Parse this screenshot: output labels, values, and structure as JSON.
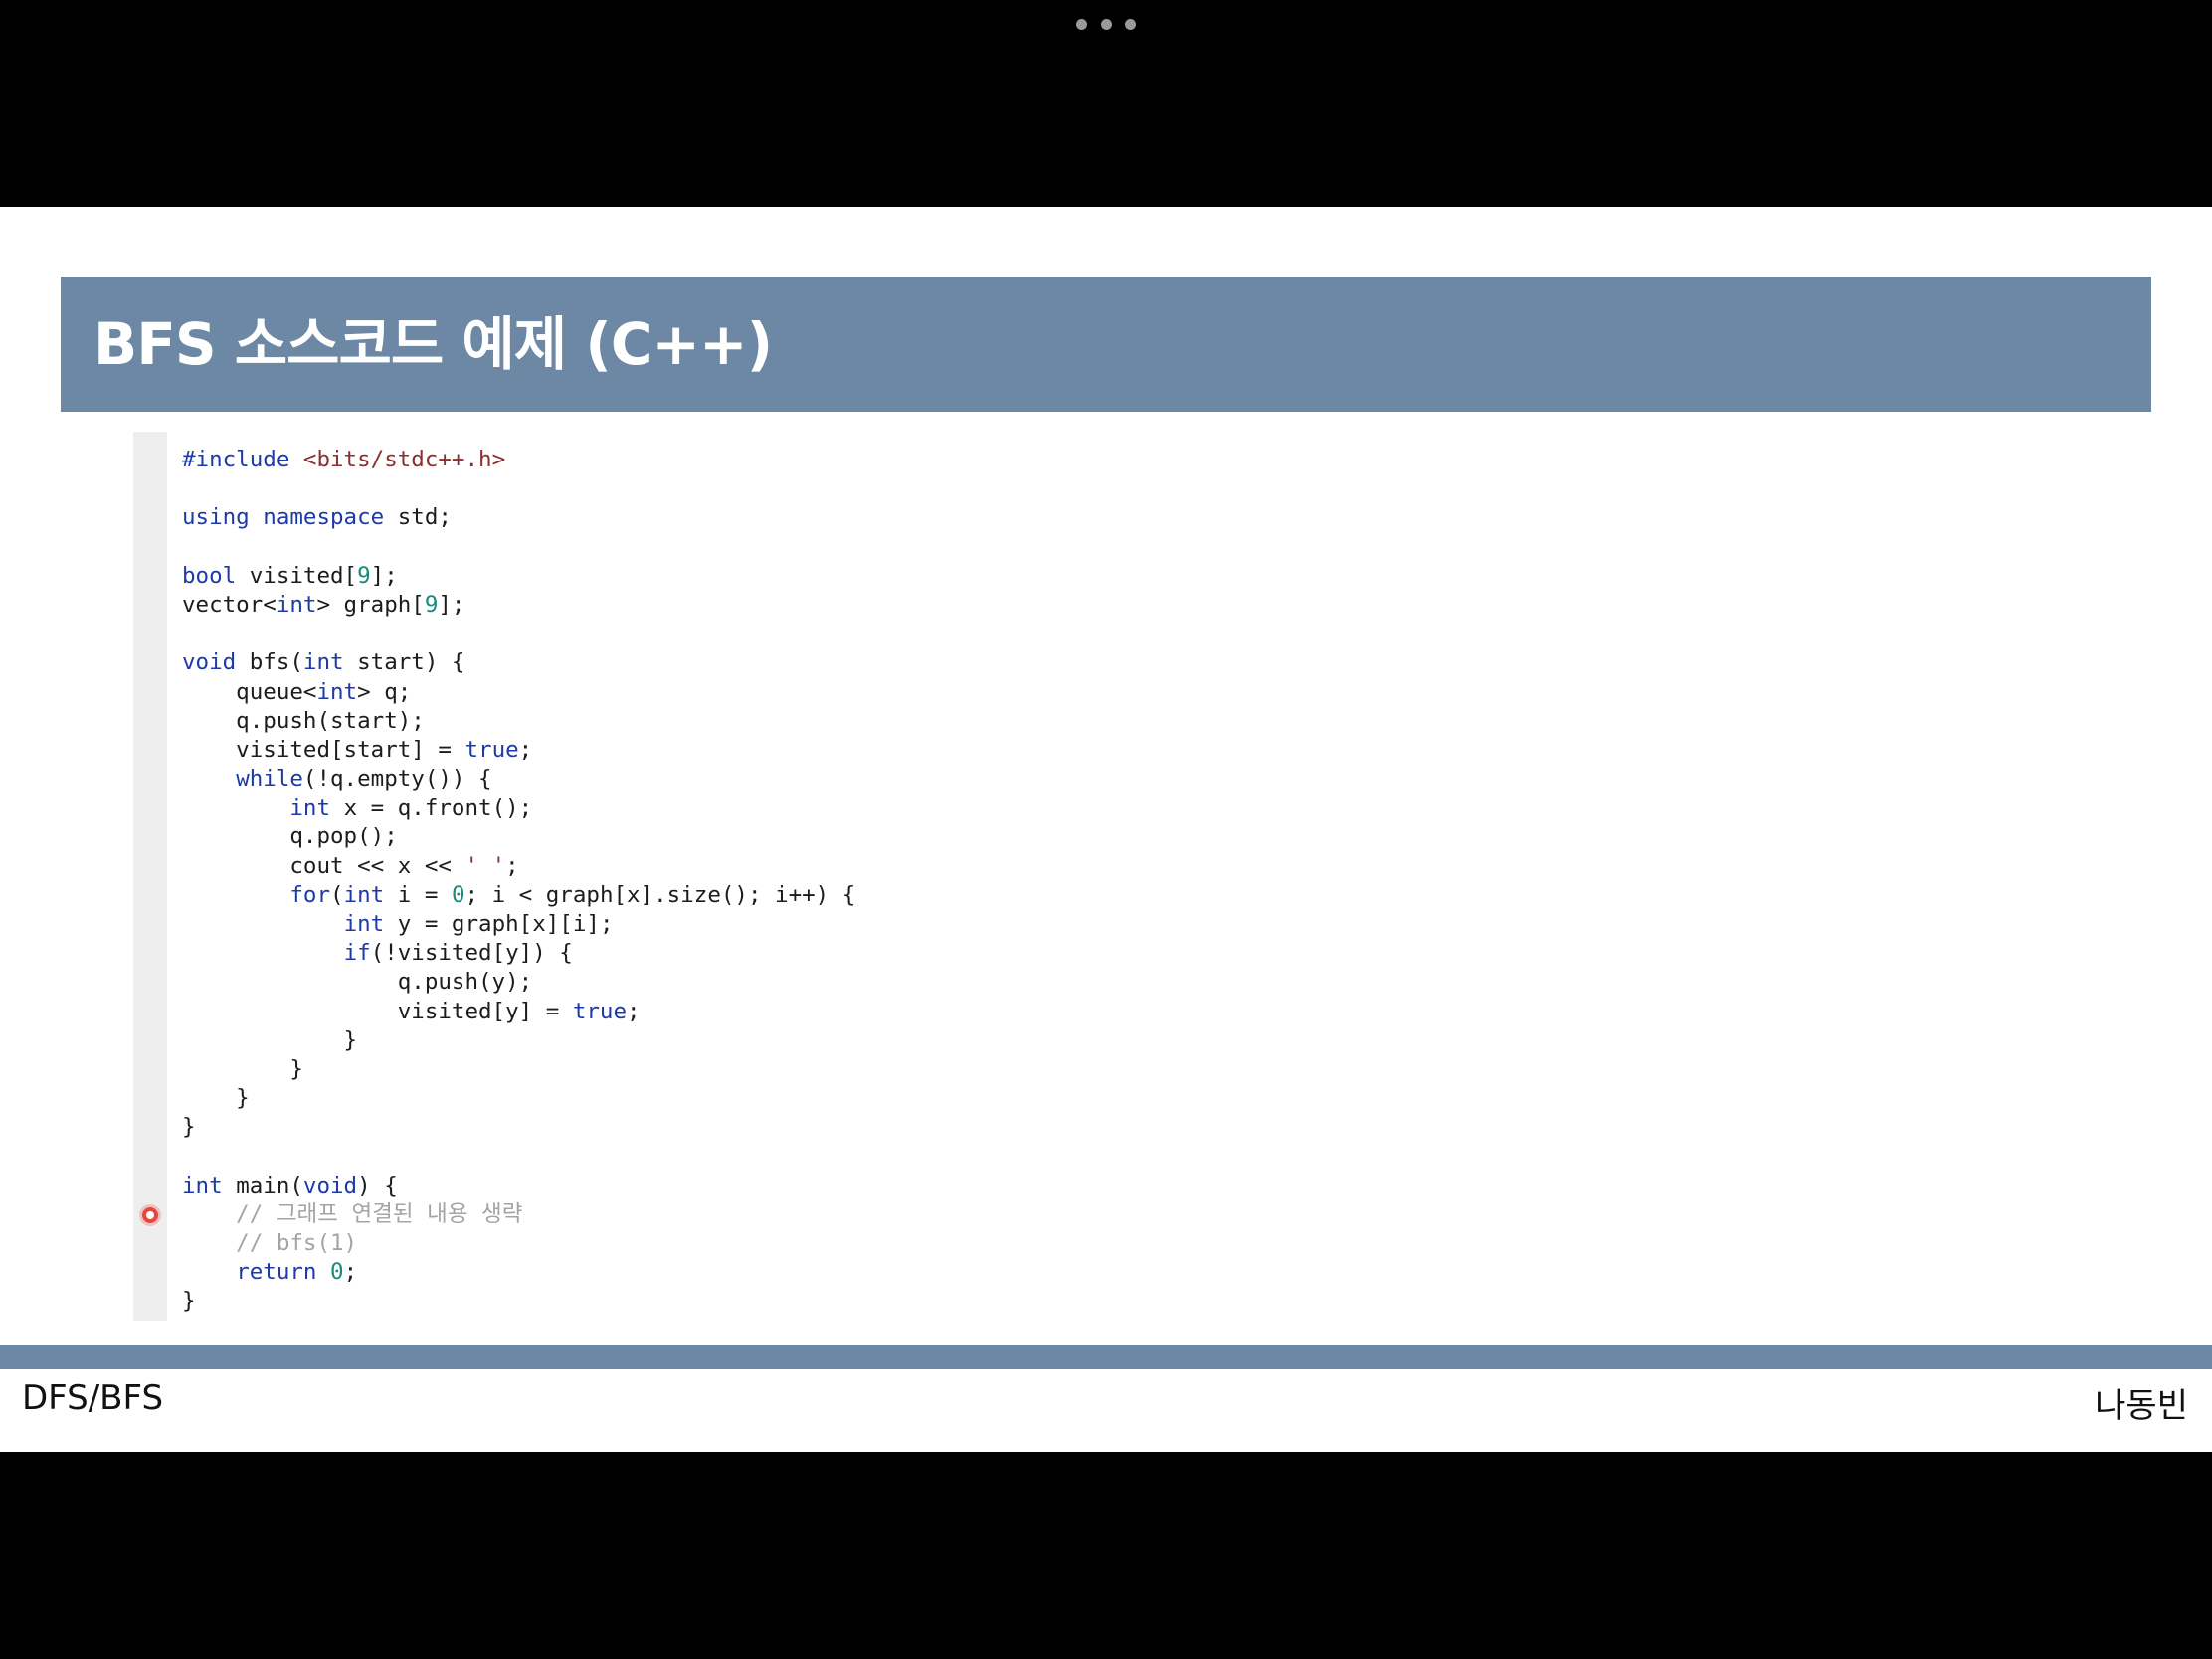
{
  "slide": {
    "title": "BFS 소스코드 예제 (C++)",
    "footer_left": "DFS/BFS",
    "footer_right": "나동빈"
  },
  "code": {
    "language": "C++",
    "lines": [
      [
        {
          "t": "#include ",
          "c": "kw"
        },
        {
          "t": "<bits/stdc++.h>",
          "c": "str"
        }
      ],
      [],
      [
        {
          "t": "using namespace ",
          "c": "kw"
        },
        {
          "t": "std;"
        }
      ],
      [],
      [
        {
          "t": "bool ",
          "c": "kw"
        },
        {
          "t": "visited["
        },
        {
          "t": "9",
          "c": "num"
        },
        {
          "t": "];"
        }
      ],
      [
        {
          "t": "vector<"
        },
        {
          "t": "int",
          "c": "kw"
        },
        {
          "t": "> graph["
        },
        {
          "t": "9",
          "c": "num"
        },
        {
          "t": "];"
        }
      ],
      [],
      [
        {
          "t": "void ",
          "c": "kw"
        },
        {
          "t": "bfs("
        },
        {
          "t": "int ",
          "c": "kw"
        },
        {
          "t": "start) {"
        }
      ],
      [
        {
          "t": "    queue<"
        },
        {
          "t": "int",
          "c": "kw"
        },
        {
          "t": "> q;"
        }
      ],
      [
        {
          "t": "    q.push(start);"
        }
      ],
      [
        {
          "t": "    visited[start] = "
        },
        {
          "t": "true",
          "c": "kw"
        },
        {
          "t": ";"
        }
      ],
      [
        {
          "t": "    "
        },
        {
          "t": "while",
          "c": "kw"
        },
        {
          "t": "(!q.empty()) {"
        }
      ],
      [
        {
          "t": "        "
        },
        {
          "t": "int ",
          "c": "kw"
        },
        {
          "t": "x = q.front();"
        }
      ],
      [
        {
          "t": "        q.pop();"
        }
      ],
      [
        {
          "t": "        cout << x << "
        },
        {
          "t": "' '",
          "c": "str"
        },
        {
          "t": ";"
        }
      ],
      [
        {
          "t": "        "
        },
        {
          "t": "for",
          "c": "kw"
        },
        {
          "t": "("
        },
        {
          "t": "int ",
          "c": "kw"
        },
        {
          "t": "i = "
        },
        {
          "t": "0",
          "c": "num"
        },
        {
          "t": "; i < graph[x].size(); i++) {"
        }
      ],
      [
        {
          "t": "            "
        },
        {
          "t": "int ",
          "c": "kw"
        },
        {
          "t": "y = graph[x][i];"
        }
      ],
      [
        {
          "t": "            "
        },
        {
          "t": "if",
          "c": "kw"
        },
        {
          "t": "(!visited[y]) {"
        }
      ],
      [
        {
          "t": "                q.push(y);"
        }
      ],
      [
        {
          "t": "                visited[y] = "
        },
        {
          "t": "true",
          "c": "kw"
        },
        {
          "t": ";"
        }
      ],
      [
        {
          "t": "            }"
        }
      ],
      [
        {
          "t": "        }"
        }
      ],
      [
        {
          "t": "    }"
        }
      ],
      [
        {
          "t": "}"
        }
      ],
      [],
      [
        {
          "t": "int ",
          "c": "kw"
        },
        {
          "t": "main("
        },
        {
          "t": "void",
          "c": "kw"
        },
        {
          "t": ") {"
        }
      ],
      [
        {
          "t": "    // 그래프 연결된 내용 생략",
          "c": "cm"
        }
      ],
      [
        {
          "t": "    // bfs(1)",
          "c": "cm"
        }
      ],
      [
        {
          "t": "    "
        },
        {
          "t": "return ",
          "c": "kw"
        },
        {
          "t": "0",
          "c": "num"
        },
        {
          "t": ";"
        }
      ],
      [
        {
          "t": "}"
        }
      ]
    ]
  }
}
